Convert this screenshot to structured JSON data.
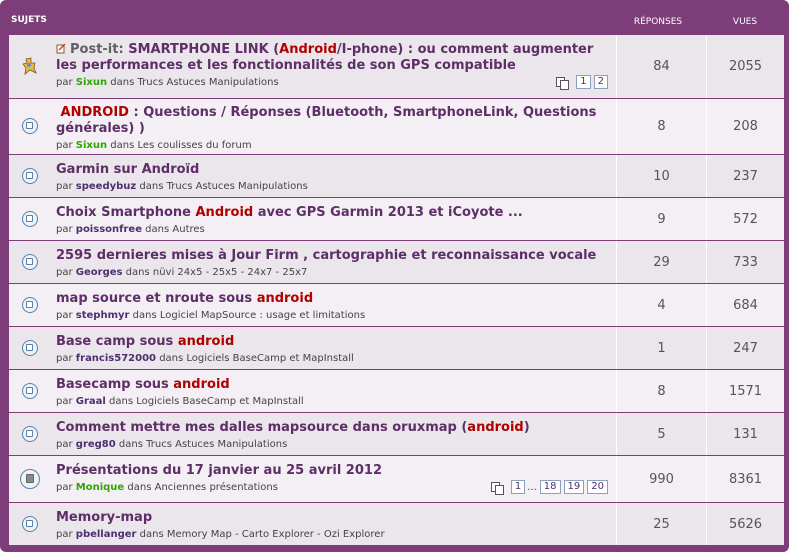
{
  "header": {
    "subjects": "SUJETS",
    "replies": "RÉPONSES",
    "views": "VUES"
  },
  "topics": [
    {
      "prefix": "Post-it: ",
      "title_parts": [
        "SMARTPHONE LINK (",
        "Android",
        "/I-phone) : ou comment augmenter les performances et les fonctionnalités de son GPS compatible"
      ],
      "by": "par",
      "author": "Sixun",
      "in": "dans",
      "forum": "Trucs Astuces Manipulations",
      "pages": [
        "1",
        "2"
      ],
      "replies": "84",
      "views": "2055"
    },
    {
      "title_parts": [
        "ANDROID",
        " : Questions / Réponses (Bluetooth, SmartphoneLink, Questions générales) )"
      ],
      "by": "par",
      "author": "Sixun",
      "in": "dans",
      "forum": "Les coulisses du forum",
      "replies": "8",
      "views": "208"
    },
    {
      "title_parts": [
        "Garmin sur Androïd"
      ],
      "by": "par",
      "author": "speedybuz",
      "in": "dans",
      "forum": "Trucs Astuces Manipulations",
      "replies": "10",
      "views": "237"
    },
    {
      "title_parts": [
        "Choix Smartphone ",
        "Android",
        " avec GPS Garmin 2013 et iCoyote ..."
      ],
      "by": "par",
      "author": "poissonfree",
      "in": "dans",
      "forum": "Autres",
      "replies": "9",
      "views": "572"
    },
    {
      "title_parts": [
        "2595 dernieres mises à Jour Firm , cartographie et reconnaissance vocale"
      ],
      "by": "par",
      "author": "Georges",
      "in": "dans",
      "forum": "nüvi 24x5 - 25x5 - 24x7 - 25x7",
      "replies": "29",
      "views": "733"
    },
    {
      "title_parts": [
        "map source et nroute sous ",
        "android"
      ],
      "by": "par",
      "author": "stephmyr",
      "in": "dans",
      "forum": "Logiciel MapSource : usage et limitations",
      "replies": "4",
      "views": "684"
    },
    {
      "title_parts": [
        "Base camp sous ",
        "android"
      ],
      "by": "par",
      "author": "francis572000",
      "in": "dans",
      "forum": "Logiciels BaseCamp et MapInstall",
      "replies": "1",
      "views": "247"
    },
    {
      "title_parts": [
        "Basecamp sous ",
        "android"
      ],
      "by": "par",
      "author": "Graal",
      "in": "dans",
      "forum": "Logiciels BaseCamp et MapInstall",
      "replies": "8",
      "views": "1571"
    },
    {
      "title_parts": [
        "Comment mettre mes dalles mapsource dans oruxmap (",
        "android",
        ")"
      ],
      "by": "par",
      "author": "greg80",
      "in": "dans",
      "forum": "Trucs Astuces Manipulations",
      "replies": "5",
      "views": "131"
    },
    {
      "title_parts": [
        "Présentations du 17 janvier au 25 avril 2012"
      ],
      "by": "par",
      "author": "Monique",
      "in": "dans",
      "forum": "Anciennes présentations",
      "pages": [
        "1",
        "...",
        "18",
        "19",
        "20"
      ],
      "replies": "990",
      "views": "8361"
    },
    {
      "title_parts": [
        "Memory-map"
      ],
      "by": "par",
      "author": "pbellanger",
      "in": "dans",
      "forum": "Memory Map - Carto Explorer - Ozi Explorer",
      "replies": "25",
      "views": "5626"
    }
  ]
}
